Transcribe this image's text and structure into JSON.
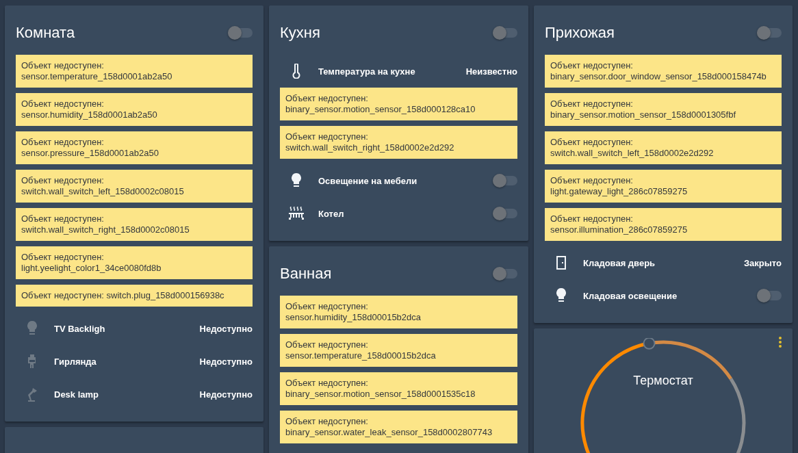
{
  "columns": [
    {
      "cards": [
        {
          "kind": "entities",
          "title": "Комната",
          "on": false,
          "warnings": [
            [
              "Объект недоступен:",
              "sensor.temperature_158d0001ab2a50"
            ],
            [
              "Объект недоступен:",
              "sensor.humidity_158d0001ab2a50"
            ],
            [
              "Объект недоступен:",
              "sensor.pressure_158d0001ab2a50"
            ],
            [
              "Объект недоступен:",
              "switch.wall_switch_left_158d0002c08015"
            ],
            [
              "Объект недоступен:",
              "switch.wall_switch_right_158d0002c08015"
            ],
            [
              "Объект недоступен:",
              "light.yeelight_color1_34ce0080fd8b"
            ],
            [
              "Объект недоступен: switch.plug_158d000156938c"
            ]
          ],
          "rows": [
            {
              "kind": "state",
              "name": "TV Backligh",
              "state": "Недоступно",
              "available": false
            },
            {
              "kind": "state",
              "name": "Гирлянда",
              "state": "Недоступно",
              "available": false
            },
            {
              "kind": "state",
              "name": "Desk lamp",
              "state": "Недоступно",
              "available": false
            }
          ]
        },
        {
          "kind": "blank"
        }
      ]
    },
    {
      "cards": [
        {
          "kind": "entities",
          "title": "Кухня",
          "on": false,
          "rows_first": [
            {
              "kind": "state",
              "name": "Температура на кухне",
              "state": "Неизвестно",
              "available": true
            }
          ],
          "warnings": [
            [
              "Объект недоступен:",
              "binary_sensor.motion_sensor_158d000128ca10"
            ],
            [
              "Объект недоступен:",
              "switch.wall_switch_right_158d0002e2d292"
            ]
          ],
          "rows": [
            {
              "kind": "switch",
              "name": "Освещение на мебели",
              "on": false,
              "available": true
            },
            {
              "kind": "switch",
              "name": "Котел",
              "on": false,
              "available": true
            }
          ]
        },
        {
          "kind": "entities",
          "title": "Ванная",
          "on": false,
          "warnings": [
            [
              "Объект недоступен:",
              "sensor.humidity_158d00015b2dca"
            ],
            [
              "Объект недоступен:",
              "sensor.temperature_158d00015b2dca"
            ],
            [
              "Объект недоступен:",
              "binary_sensor.motion_sensor_158d0001535c18"
            ],
            [
              "Объект недоступен:",
              "binary_sensor.water_leak_sensor_158d0002807743"
            ]
          ]
        }
      ]
    },
    {
      "cards": [
        {
          "kind": "entities",
          "title": "Прихожая",
          "on": false,
          "warnings": [
            [
              "Объект недоступен:",
              "binary_sensor.door_window_sensor_158d000158474b"
            ],
            [
              "Объект недоступен:",
              "binary_sensor.motion_sensor_158d0001305fbf"
            ],
            [
              "Объект недоступен:",
              "switch.wall_switch_left_158d0002e2d292"
            ],
            [
              "Объект недоступен:",
              "light.gateway_light_286c07859275"
            ],
            [
              "Объект недоступен:",
              "sensor.illumination_286c07859275"
            ]
          ],
          "rows": [
            {
              "kind": "state",
              "name": "Кладовая дверь",
              "state": "Закрыто",
              "available": true
            },
            {
              "kind": "switch",
              "name": "Кладовая освещение",
              "on": false,
              "available": true
            }
          ]
        },
        {
          "kind": "thermostat",
          "title": "Термостат"
        }
      ]
    }
  ]
}
